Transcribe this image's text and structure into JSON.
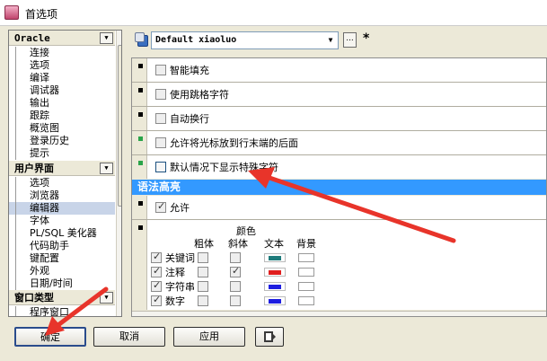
{
  "window": {
    "title": "首选项",
    "icon": "app-icon"
  },
  "left_panel": {
    "groups": [
      {
        "name": "Oracle",
        "items": [
          "连接",
          "选项",
          "编译",
          "调试器",
          "输出",
          "跟踪",
          "概览图",
          "登录历史",
          "提示"
        ]
      },
      {
        "name": "用户界面",
        "items": [
          "选项",
          "浏览器",
          "编辑器",
          "字体",
          "PL/SQL 美化器",
          "代码助手",
          "键配置",
          "外观",
          "日期/时间"
        ],
        "selected_index": 2
      },
      {
        "name": "窗口类型",
        "items": [
          "程序窗口"
        ]
      }
    ]
  },
  "profile": {
    "value": "Default xiaoluo",
    "more_label": "...",
    "modified_marker": "*"
  },
  "settings": {
    "rows": [
      {
        "label": "智能填充",
        "checked": false,
        "marker": "black"
      },
      {
        "label": "使用跳格字符",
        "checked": false,
        "marker": "black"
      },
      {
        "label": "自动换行",
        "checked": false,
        "marker": "black"
      },
      {
        "label": "允许将光标放到行末端的后面",
        "checked": false,
        "marker": "green"
      },
      {
        "label": "默认情况下显示特殊字符",
        "checked": false,
        "marker": "green"
      }
    ],
    "syntax_section": {
      "title": "语法高亮",
      "enable_label": "允许",
      "enable_checked": true,
      "headers": {
        "bold": "粗体",
        "italic": "斜体",
        "color": "颜色",
        "text": "文本",
        "background": "背景"
      },
      "items": [
        {
          "label": "关键词",
          "checked": true,
          "bold": false,
          "italic": false,
          "text_color": "#1e7b7b"
        },
        {
          "label": "注释",
          "checked": true,
          "bold": false,
          "italic": true,
          "text_color": "#e01e1e"
        },
        {
          "label": "字符串",
          "checked": true,
          "bold": false,
          "italic": false,
          "text_color": "#1e1ee0"
        },
        {
          "label": "数字",
          "checked": true,
          "bold": false,
          "italic": false,
          "text_color": "#1e1ee0"
        }
      ]
    }
  },
  "buttons": {
    "ok": "确定",
    "cancel": "取消",
    "apply": "应用",
    "help_icon": "help-icon"
  },
  "annotations": {
    "arrow_color": "#e8342a"
  }
}
